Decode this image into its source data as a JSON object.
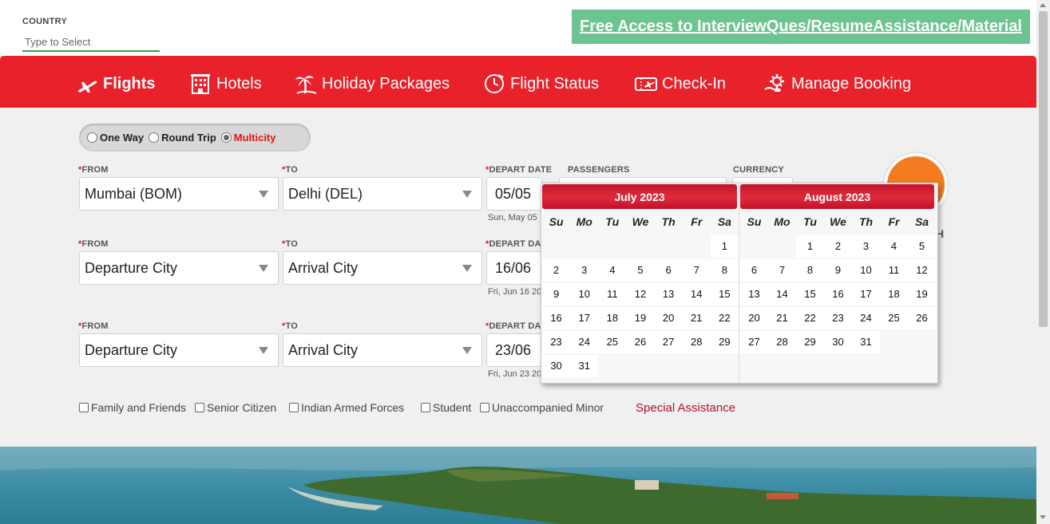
{
  "country": {
    "label": "COUNTRY",
    "placeholder": "Type to Select"
  },
  "promo": {
    "text": "Free Access to InterviewQues/ResumeAssistance/Material"
  },
  "nav": {
    "items": [
      {
        "label": "Flights",
        "icon": "plane-icon"
      },
      {
        "label": "Hotels",
        "icon": "hotel-icon"
      },
      {
        "label": "Holiday Packages",
        "icon": "palm-tree-icon"
      },
      {
        "label": "Flight Status",
        "icon": "clock-plane-icon"
      },
      {
        "label": "Check-In",
        "icon": "ticket-icon"
      },
      {
        "label": "Manage Booking",
        "icon": "gear-hand-icon"
      }
    ],
    "active": "Flights"
  },
  "trip_type": {
    "options": [
      "One Way",
      "Round Trip",
      "Multicity"
    ],
    "selected": "Multicity"
  },
  "form": {
    "required_mark": "*",
    "from_label": "FROM",
    "to_label": "TO",
    "depart_label": "DEPART DATE",
    "depart_label_cut": "DEPART DA",
    "passengers_label": "PASSENGERS",
    "currency_label": "CURRENCY",
    "rows": [
      {
        "from": "Mumbai (BOM)",
        "to": "Delhi (DEL)",
        "date": "05/05",
        "date_sub": "Sun, May 05"
      },
      {
        "from": "Departure City",
        "to": "Arrival City",
        "date": "16/06",
        "date_sub": "Fri, Jun 16 20"
      },
      {
        "from": "Departure City",
        "to": "Arrival City",
        "date": "23/06",
        "date_sub": "Fri, Jun 23 20"
      }
    ],
    "search_peek": "H"
  },
  "discounts": [
    "Family and Friends",
    "Senior Citizen",
    "Indian Armed Forces",
    "Student",
    "Unaccompanied Minor"
  ],
  "special_assistance": "Special Assistance",
  "calendar": {
    "weekdays": [
      "Su",
      "Mo",
      "Tu",
      "We",
      "Th",
      "Fr",
      "Sa"
    ],
    "months": [
      {
        "title": "July 2023",
        "first_weekday": 6,
        "days": 31
      },
      {
        "title": "August 2023",
        "first_weekday": 2,
        "days": 31
      }
    ]
  },
  "colors": {
    "brand_red": "#e8212b",
    "search_orange": "#f47b20",
    "promo_green": "#6cc490",
    "link_red": "#b3122a"
  }
}
